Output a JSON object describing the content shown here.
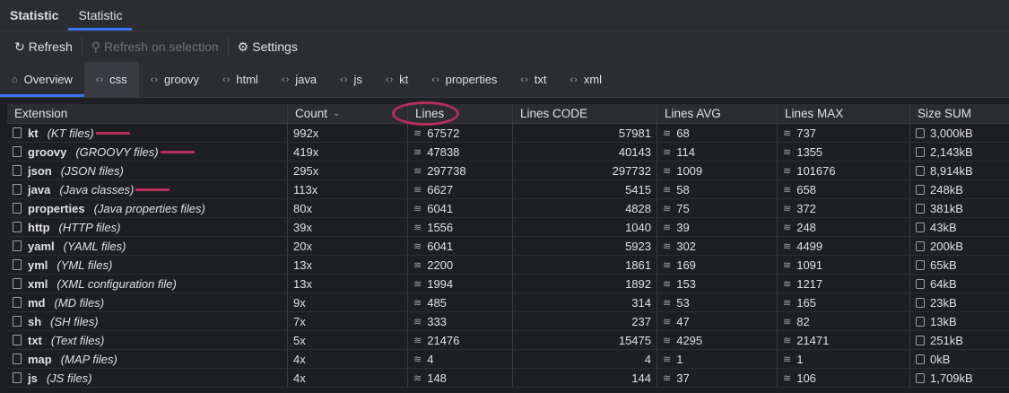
{
  "window_tabs": [
    "Statistic",
    "Statistic"
  ],
  "toolbar": {
    "refresh": "Refresh",
    "refresh_on_selection": "Refresh on selection",
    "settings": "Settings"
  },
  "tabs": [
    "Overview",
    "css",
    "groovy",
    "html",
    "java",
    "js",
    "kt",
    "properties",
    "txt",
    "xml"
  ],
  "columns": [
    "Extension",
    "Count",
    "Lines",
    "Lines CODE",
    "Lines AVG",
    "Lines MAX",
    "Size SUM"
  ],
  "highlight_color": "#b4305a",
  "rows": [
    {
      "ext": "kt",
      "desc": "(KT files)",
      "count": "992x",
      "lines": "67572",
      "code": "57981",
      "avg": "68",
      "max": "737",
      "size": "3,000kB",
      "mark": true
    },
    {
      "ext": "groovy",
      "desc": "(GROOVY files)",
      "count": "419x",
      "lines": "47838",
      "code": "40143",
      "avg": "114",
      "max": "1355",
      "size": "2,143kB",
      "mark": true
    },
    {
      "ext": "json",
      "desc": "(JSON files)",
      "count": "295x",
      "lines": "297738",
      "code": "297732",
      "avg": "1009",
      "max": "101676",
      "size": "8,914kB"
    },
    {
      "ext": "java",
      "desc": "(Java classes)",
      "count": "113x",
      "lines": "6627",
      "code": "5415",
      "avg": "58",
      "max": "658",
      "size": "248kB",
      "mark": true
    },
    {
      "ext": "properties",
      "desc": "(Java properties files)",
      "count": "80x",
      "lines": "6041",
      "code": "4828",
      "avg": "75",
      "max": "372",
      "size": "381kB"
    },
    {
      "ext": "http",
      "desc": "(HTTP files)",
      "count": "39x",
      "lines": "1556",
      "code": "1040",
      "avg": "39",
      "max": "248",
      "size": "43kB"
    },
    {
      "ext": "yaml",
      "desc": "(YAML files)",
      "count": "20x",
      "lines": "6041",
      "code": "5923",
      "avg": "302",
      "max": "4499",
      "size": "200kB"
    },
    {
      "ext": "yml",
      "desc": "(YML files)",
      "count": "13x",
      "lines": "2200",
      "code": "1861",
      "avg": "169",
      "max": "1091",
      "size": "65kB"
    },
    {
      "ext": "xml",
      "desc": "(XML configuration file)",
      "count": "13x",
      "lines": "1994",
      "code": "1892",
      "avg": "153",
      "max": "1217",
      "size": "64kB"
    },
    {
      "ext": "md",
      "desc": "(MD files)",
      "count": "9x",
      "lines": "485",
      "code": "314",
      "avg": "53",
      "max": "165",
      "size": "23kB"
    },
    {
      "ext": "sh",
      "desc": "(SH files)",
      "count": "7x",
      "lines": "333",
      "code": "237",
      "avg": "47",
      "max": "82",
      "size": "13kB"
    },
    {
      "ext": "txt",
      "desc": "(Text files)",
      "count": "5x",
      "lines": "21476",
      "code": "15475",
      "avg": "4295",
      "max": "21471",
      "size": "251kB"
    },
    {
      "ext": "map",
      "desc": "(MAP files)",
      "count": "4x",
      "lines": "4",
      "code": "4",
      "avg": "1",
      "max": "1",
      "size": "0kB"
    },
    {
      "ext": "js",
      "desc": "(JS files)",
      "count": "4x",
      "lines": "148",
      "code": "144",
      "avg": "37",
      "max": "106",
      "size": "1,709kB"
    }
  ]
}
